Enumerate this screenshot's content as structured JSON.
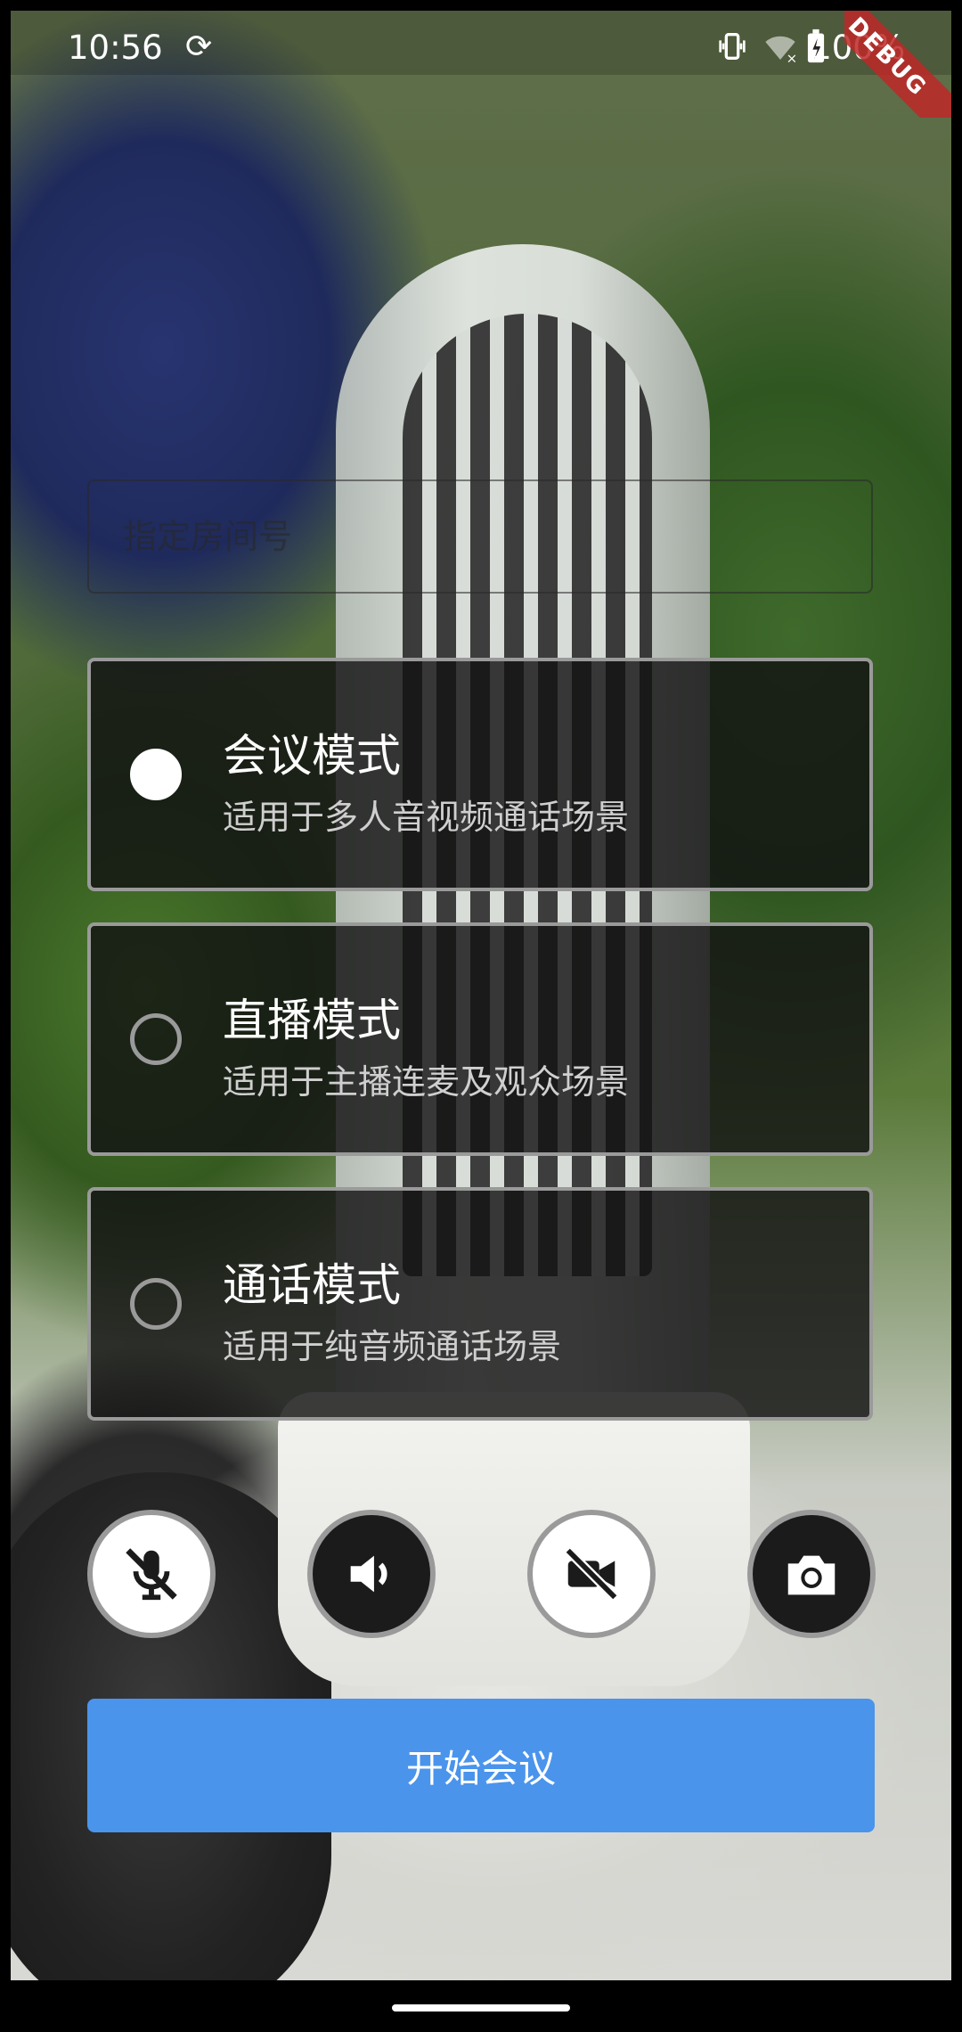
{
  "status_bar": {
    "time": "10:56",
    "battery_percent": "100%",
    "debug_label": "DEBUG"
  },
  "room_input": {
    "placeholder": "指定房间号",
    "value": ""
  },
  "modes": [
    {
      "title": "会议模式",
      "description": "适用于多人音视频通话场景",
      "selected": true
    },
    {
      "title": "直播模式",
      "description": "适用于主播连麦及观众场景",
      "selected": false
    },
    {
      "title": "通话模式",
      "description": "适用于纯音频通话场景",
      "selected": false
    }
  ],
  "controls": [
    {
      "icon": "mic-off-icon",
      "state": "off"
    },
    {
      "icon": "speaker-icon",
      "state": "on"
    },
    {
      "icon": "camera-off-icon",
      "state": "off"
    },
    {
      "icon": "switch-camera-icon",
      "state": "on"
    }
  ],
  "start_button": {
    "label": "开始会议"
  },
  "colors": {
    "primary": "#4a94ec",
    "card_background": "#121212",
    "card_border": "#9a9a9a",
    "debug_banner": "#be2828"
  }
}
